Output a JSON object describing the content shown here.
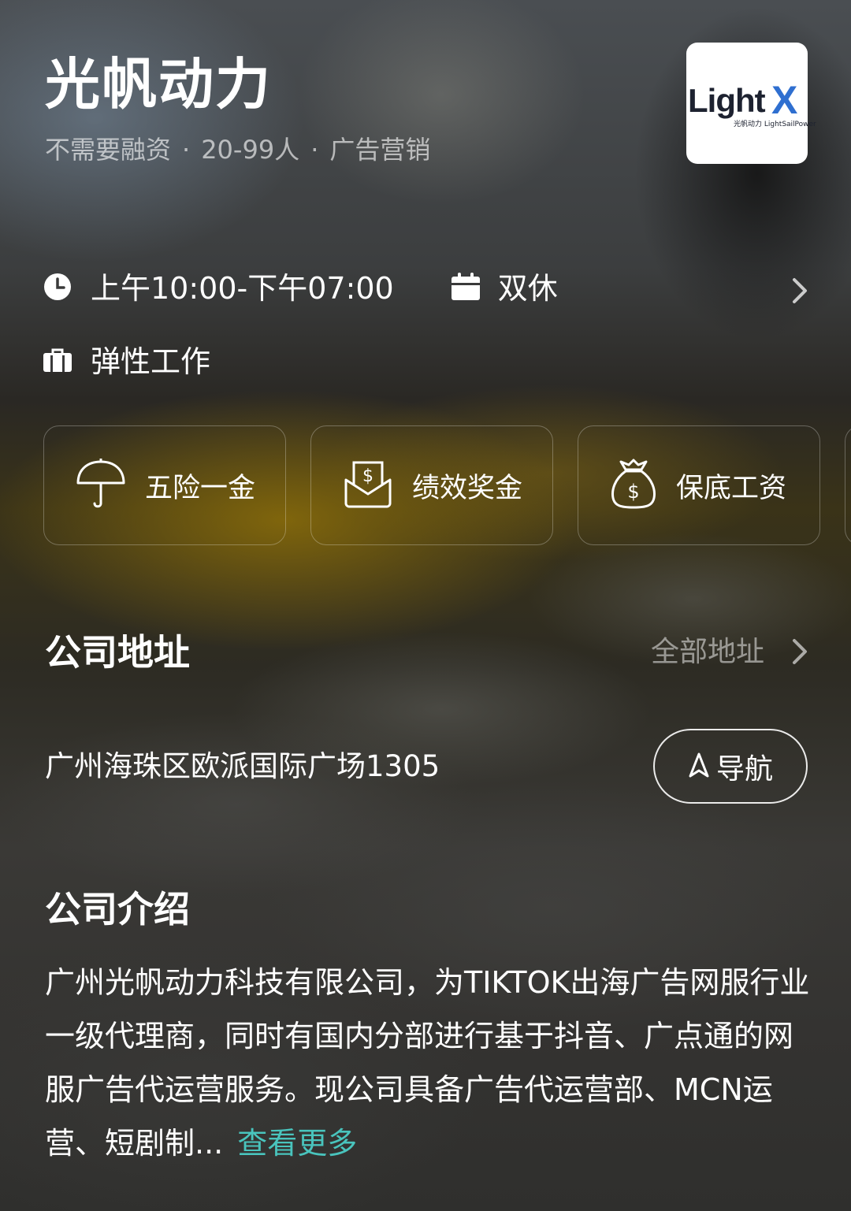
{
  "company": {
    "name": "光帆动力",
    "financing": "不需要融资",
    "size": "20-99人",
    "industry": "广告营销",
    "separator": "·",
    "logo_text": "LightX",
    "logo_subtext": "光帆动力 LightSailPower"
  },
  "work": {
    "hours": "上午10:00-下午07:00",
    "rest": "双休",
    "mode": "弹性工作"
  },
  "benefits": [
    {
      "label": "五险一金",
      "icon": "umbrella-icon"
    },
    {
      "label": "绩效奖金",
      "icon": "money-envelope-icon"
    },
    {
      "label": "保底工资",
      "icon": "money-bag-icon"
    }
  ],
  "address_section": {
    "title": "公司地址",
    "all_label": "全部地址",
    "address": "广州海珠区欧派国际广场1305",
    "nav_label": "导航"
  },
  "intro_section": {
    "title": "公司介绍",
    "text": "广州光帆动力科技有限公司，为TIKTOK出海广告网服行业一级代理商，同时有国内分部进行基于抖音、广点通的网服广告代运营服务。现公司具备广告代运营部、MCN运营、短剧制...",
    "more_label": "查看更多"
  },
  "colors": {
    "accent": "#49c4bd"
  }
}
